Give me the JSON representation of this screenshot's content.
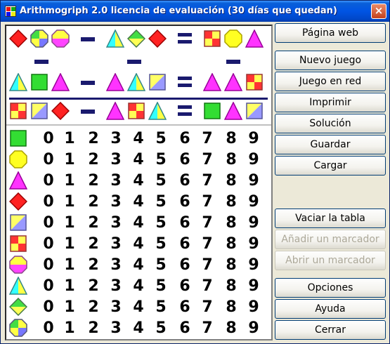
{
  "window": {
    "title": "Arithmogriph 2.0 licencia de evaluación (30 días que quedan)",
    "close_label": "×"
  },
  "buttons": {
    "web": "Página web",
    "new_game": "Nuevo juego",
    "net_game": "Juego en red",
    "print": "Imprimir",
    "solution": "Solución",
    "save": "Guardar",
    "load": "Cargar",
    "clear_table": "Vaciar la tabla",
    "add_marker": "Añadir un marcador",
    "open_marker": "Abrir un marcador",
    "options": "Opciones",
    "help": "Ayuda",
    "close": "Cerrar"
  },
  "digits": [
    "0",
    "1",
    "2",
    "3",
    "4",
    "5",
    "6",
    "7",
    "8",
    "9"
  ],
  "table_shapes": [
    "square-green",
    "octagon-yellow",
    "triangle-pink",
    "diamond-red",
    "square-diag-blue-yellow",
    "square-checker-red",
    "octagon-pink-half",
    "triangle-cyan-yellow",
    "diamond-green-yellow",
    "octagon-checker-blue"
  ],
  "equations": {
    "row1": [
      "diamond-red",
      "octagon-checker-blue",
      "octagon-pink-half",
      "minus",
      "triangle-cyan-yellow",
      "diamond-green-yellow",
      "diamond-red",
      "equals",
      "square-checker-red",
      "octagon-yellow",
      "triangle-pink"
    ],
    "row3": [
      "triangle-cyan-yellow",
      "square-green",
      "triangle-pink",
      "minus",
      "triangle-pink",
      "triangle-cyan-yellow",
      "square-diag-blue-yellow",
      "equals",
      "triangle-pink",
      "triangle-pink",
      "square-checker-red"
    ],
    "row4": [
      "square-checker-red",
      "square-diag-blue-yellow",
      "diamond-red",
      "minus",
      "triangle-pink",
      "square-checker-red",
      "triangle-cyan-yellow",
      "equals",
      "square-green",
      "triangle-pink",
      "square-diag-blue-yellow"
    ]
  }
}
